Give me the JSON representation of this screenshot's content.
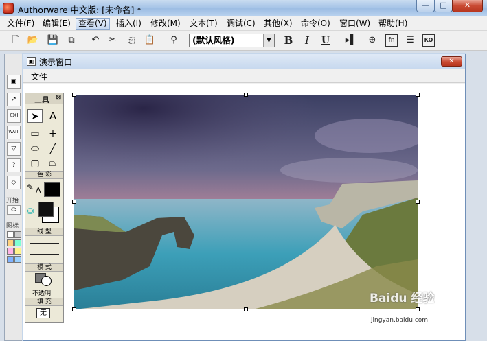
{
  "app": {
    "title": "Authorware 中文版: [未命名] *",
    "window_buttons": {
      "minimize": "—",
      "maximize": "□",
      "close": "✕"
    }
  },
  "menubar": [
    {
      "label": "文件(F)"
    },
    {
      "label": "编辑(E)"
    },
    {
      "label": "查看(V)"
    },
    {
      "label": "插入(I)"
    },
    {
      "label": "修改(M)"
    },
    {
      "label": "文本(T)"
    },
    {
      "label": "调试(C)"
    },
    {
      "label": "其他(X)"
    },
    {
      "label": "命令(O)"
    },
    {
      "label": "窗口(W)"
    },
    {
      "label": "帮助(H)"
    }
  ],
  "toolbar": {
    "style_select": "(默认风格)",
    "bold": "B",
    "italic": "I",
    "underline": "U",
    "fn_label": "fn",
    "ko_label": "KO"
  },
  "palette": {
    "wait_label": "WAIT",
    "start_label": "开始",
    "color_label": "图标"
  },
  "presentation": {
    "title": "演示窗口",
    "menu_file": "文件",
    "close": "✕"
  },
  "tools": {
    "title": "工具",
    "close": "⊠",
    "text_tool": "A",
    "color_section": "色 彩",
    "line_section": "线 型",
    "mode_section": "模 式",
    "mode_value": "不透明",
    "fill_section": "填 充",
    "fill_value": "无",
    "color_a": "A"
  },
  "watermark": {
    "brand": "Baidu 经验",
    "url": "jingyan.baidu.com"
  },
  "colors": {
    "title_gradient_top": "#c9dcf0",
    "close_red": "#c94a33",
    "workspace": "#d7dfe9"
  }
}
